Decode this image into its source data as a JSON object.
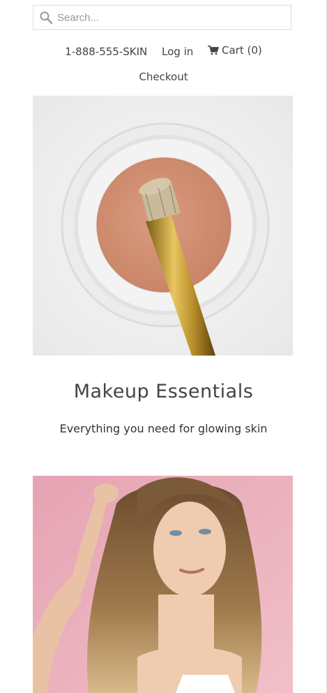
{
  "search": {
    "placeholder": "Search..."
  },
  "nav": {
    "phone": "1-888-555-SKIN",
    "login": "Log in",
    "cart": "Cart (0)",
    "checkout": "Checkout"
  },
  "feature": {
    "title": "Makeup Essentials",
    "subtitle": "Everything you need for glowing skin"
  },
  "icons": [
    "search-icon",
    "cart-icon"
  ]
}
